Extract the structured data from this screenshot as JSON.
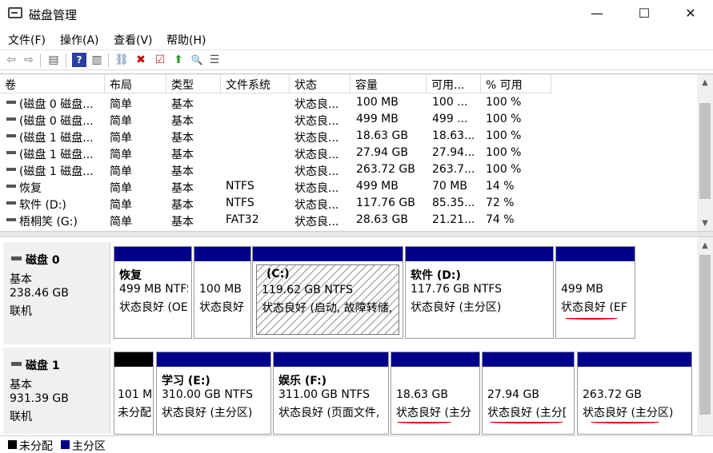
{
  "window": {
    "title": "磁盘管理",
    "minimize": "—",
    "maximize": "☐",
    "close": "✕"
  },
  "menu": [
    "文件(F)",
    "操作(A)",
    "查看(V)",
    "帮助(H)"
  ],
  "toolbar": {
    "icons": [
      "back-icon",
      "forward-icon",
      "console-tree-icon",
      "help-icon",
      "properties-icon",
      "connect-icon",
      "delete-icon",
      "check-icon",
      "up-arrow-icon",
      "search-icon",
      "list-icon"
    ],
    "glyphs": [
      "⇦",
      "⇨",
      "▤",
      "?",
      "▥",
      "⛓",
      "✖",
      "☑",
      "⬆",
      "🔍",
      "☰"
    ]
  },
  "volume_table": {
    "headers": [
      "卷",
      "布局",
      "类型",
      "文件系统",
      "状态",
      "容量",
      "可用...",
      "% 可用"
    ],
    "rows": [
      [
        "(磁盘 0 磁盘...",
        "简单",
        "基本",
        "",
        "状态良...",
        "100 MB",
        "100 ...",
        "100 %"
      ],
      [
        "(磁盘 0 磁盘...",
        "简单",
        "基本",
        "",
        "状态良...",
        "499 MB",
        "499 ...",
        "100 %"
      ],
      [
        "(磁盘 1 磁盘...",
        "简单",
        "基本",
        "",
        "状态良...",
        "18.63 GB",
        "18.63...",
        "100 %"
      ],
      [
        "(磁盘 1 磁盘...",
        "简单",
        "基本",
        "",
        "状态良...",
        "27.94 GB",
        "27.94...",
        "100 %"
      ],
      [
        "(磁盘 1 磁盘...",
        "简单",
        "基本",
        "",
        "状态良...",
        "263.72 GB",
        "263.7...",
        "100 %"
      ],
      [
        "恢复",
        "简单",
        "基本",
        "NTFS",
        "状态良...",
        "499 MB",
        "70 MB",
        "14 %"
      ],
      [
        "软件 (D:)",
        "简单",
        "基本",
        "NTFS",
        "状态良...",
        "117.76 GB",
        "85.35...",
        "72 %"
      ],
      [
        "梧桐笑 (G:)",
        "简单",
        "基本",
        "FAT32",
        "状态良...",
        "28.63 GB",
        "21.21...",
        "74 %"
      ]
    ]
  },
  "disks": [
    {
      "name": "磁盘 0",
      "type": "基本",
      "size": "238.46 GB",
      "status": "联机",
      "partitions": [
        {
          "title": "恢复",
          "size": "499 MB NTFS",
          "status": "状态良好 (OE"
        },
        {
          "title": "",
          "size": "100 MB",
          "status": "状态良好"
        },
        {
          "title": "(C:)",
          "size": "119.62 GB NTFS",
          "status": "状态良好 (启动, 故障转储,"
        },
        {
          "title": "软件  (D:)",
          "size": "117.76 GB NTFS",
          "status": "状态良好 (主分区)"
        },
        {
          "title": "",
          "size": "499 MB",
          "status": "状态良好 (EF"
        }
      ]
    },
    {
      "name": "磁盘 1",
      "type": "基本",
      "size": "931.39 GB",
      "status": "联机",
      "partitions": [
        {
          "title": "",
          "size": "101 M",
          "status": "未分配"
        },
        {
          "title": "学习  (E:)",
          "size": "310.00 GB NTFS",
          "status": "状态良好 (主分区)"
        },
        {
          "title": "娱乐  (F:)",
          "size": "311.00 GB NTFS",
          "status": "状态良好 (页面文件,"
        },
        {
          "title": "",
          "size": "18.63 GB",
          "status": "状态良好 (主分"
        },
        {
          "title": "",
          "size": "27.94 GB",
          "status": "状态良好 (主分["
        },
        {
          "title": "",
          "size": "263.72 GB",
          "status": "状态良好 (主分区)"
        }
      ]
    }
  ],
  "legend": [
    {
      "label": "未分配",
      "color": "#000000"
    },
    {
      "label": "主分区",
      "color": "#00008b"
    }
  ],
  "colors": {
    "primary_partition": "#00008b",
    "unallocated": "#000000",
    "annotation": "#e00000"
  }
}
